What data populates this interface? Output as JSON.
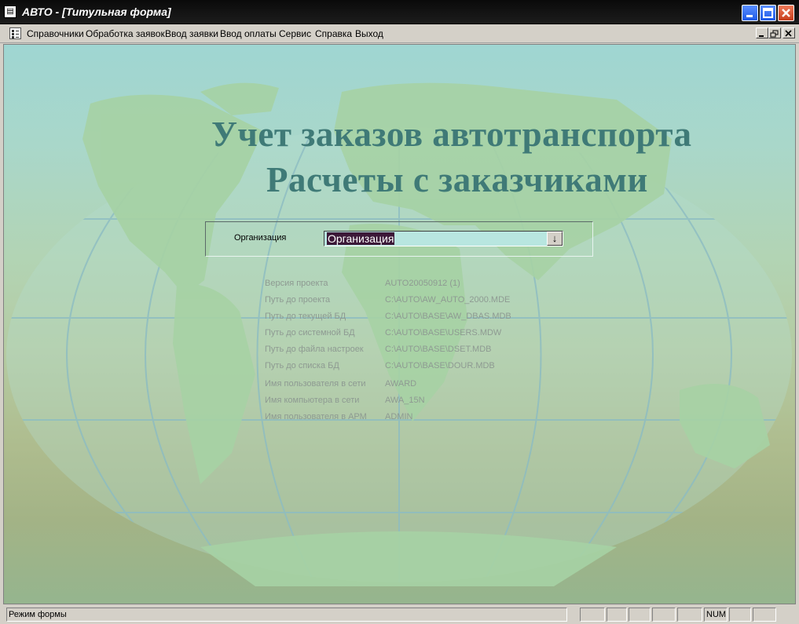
{
  "window": {
    "title": "АВТО - [Титульная форма]"
  },
  "menu": {
    "items": [
      "Справочники",
      "Обработка заявок",
      "Ввод заявки",
      "Ввод оплаты",
      "Сервис",
      "Справка",
      "Выход"
    ]
  },
  "header": {
    "line1": "Учет заказов автотранспорта",
    "line2": "Расчеты с заказчиками"
  },
  "org": {
    "label": "Организация",
    "value": "Организация"
  },
  "info": [
    {
      "label": "Версия проекта",
      "value": "AUTO20050912  (1)"
    },
    {
      "label": "Путь до проекта",
      "value": "C:\\AUTO\\AW_AUTO_2000.MDE"
    },
    {
      "label": "Путь до текущей БД",
      "value": "C:\\AUTO\\BASE\\AW_DBAS.MDB"
    },
    {
      "label": "Путь до системной БД",
      "value": "C:\\AUTO\\BASE\\USERS.MDW"
    },
    {
      "label": "Путь до файла настроек",
      "value": "C:\\AUTO\\BASE\\DSET.MDB"
    },
    {
      "label": "Путь до списка БД",
      "value": "C:\\AUTO\\BASE\\DOUR.MDB"
    },
    {
      "label": "Имя пользователя в сети",
      "value": "AWARD"
    },
    {
      "label": "Имя компьютера в сети",
      "value": "AWA_15N"
    },
    {
      "label": "Имя пользователя в АРМ",
      "value": "ADMIN"
    }
  ],
  "status": {
    "mode": "Режим формы",
    "num": "NUM"
  },
  "colors": {
    "title_text": "#3f7a77",
    "map_land": "#a8d4a6",
    "grid": "#8fbcc0",
    "titlebar": "#0a0a0a"
  }
}
